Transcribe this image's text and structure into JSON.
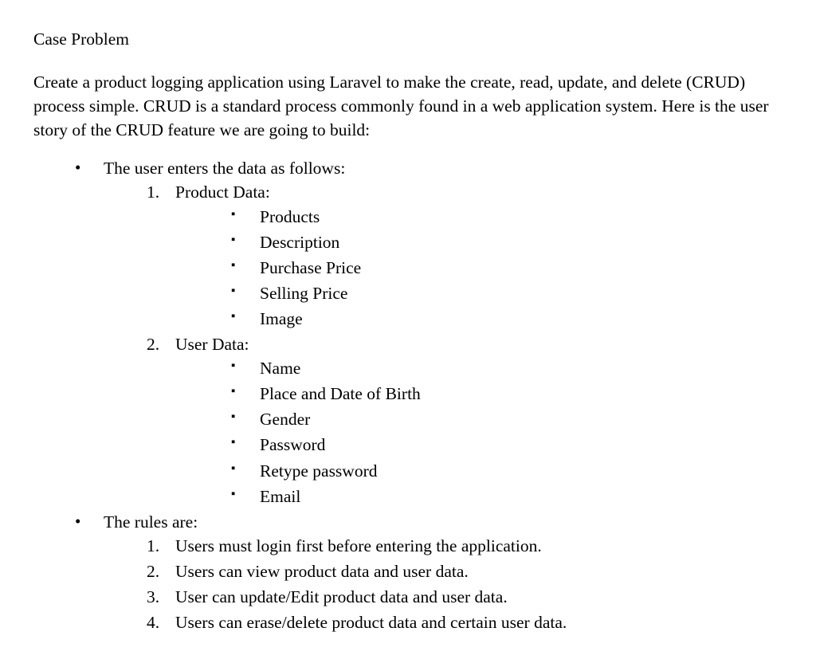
{
  "title": "Case Problem",
  "intro": "Create a product logging application using Laravel to make the create, read, update, and delete (CRUD) process simple. CRUD is a standard process commonly found in a web application system. Here is the user story of the CRUD feature we are going to build:",
  "section1": {
    "heading": "The user enters the data as follows:",
    "items": {
      "product": {
        "label": "Product Data:",
        "fields": [
          "Products",
          "Description",
          "Purchase Price",
          "Selling Price",
          "Image"
        ]
      },
      "user": {
        "label": "User Data:",
        "fields": [
          "Name",
          "Place and Date of Birth",
          "Gender",
          "Password",
          "Retype password",
          "Email"
        ]
      }
    }
  },
  "section2": {
    "heading": "The rules are:",
    "rules": [
      "Users must login first before entering the application.",
      "Users can view product data and user data.",
      "User can update/Edit product data and user data.",
      "Users can erase/delete product data and certain user data."
    ]
  }
}
